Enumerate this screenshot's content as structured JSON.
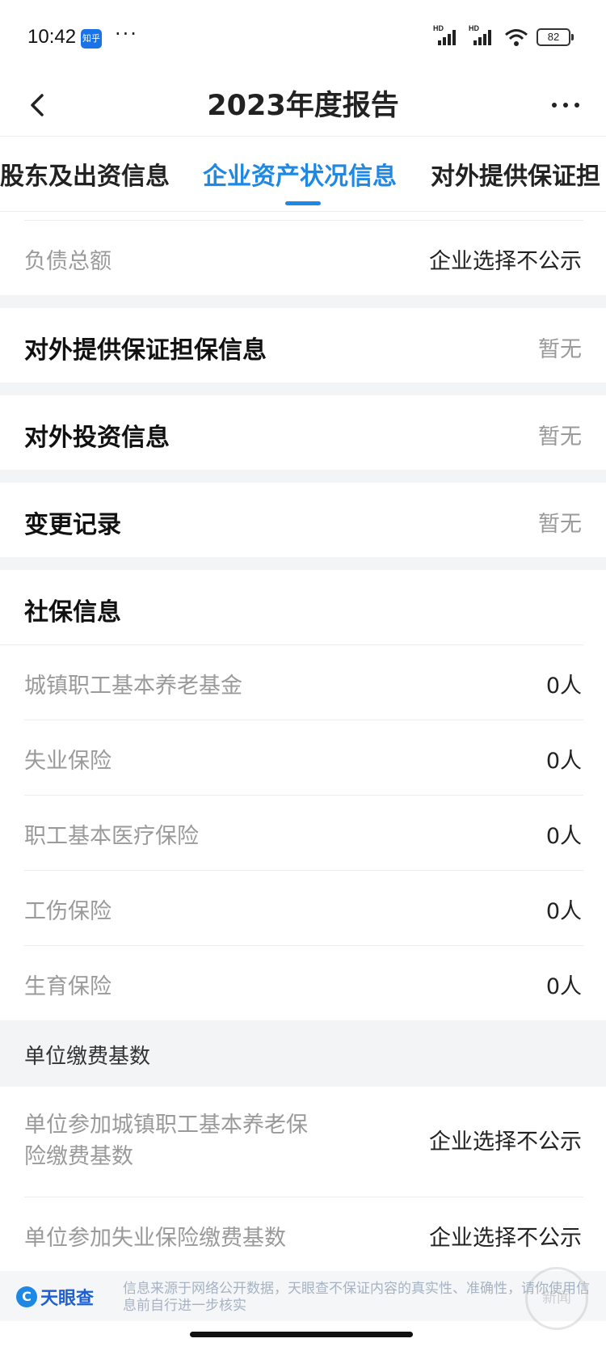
{
  "status_bar": {
    "time": "10:42",
    "app_icon_text": "知乎",
    "signal_1": "HD",
    "signal_2": "HD",
    "battery": "82"
  },
  "header": {
    "title": "2023年度报告",
    "back_icon": "chevron-left-icon",
    "more_icon": "more-horizontal-icon"
  },
  "tabs": [
    {
      "label": "股东及出资信息"
    },
    {
      "label": "企业资产状况信息",
      "active": true
    },
    {
      "label": "对外提供保证担"
    }
  ],
  "accent_color": "#1e88e5",
  "asset_rows": [
    {
      "label": "负债总额",
      "value": "企业选择不公示"
    }
  ],
  "sections": [
    {
      "title": "对外提供保证担保信息",
      "value": "暂无"
    },
    {
      "title": "对外投资信息",
      "value": "暂无"
    },
    {
      "title": "变更记录",
      "value": "暂无"
    }
  ],
  "social_security": {
    "title": "社保信息",
    "rows": [
      {
        "label": "城镇职工基本养老基金",
        "value": "0人"
      },
      {
        "label": "失业保险",
        "value": "0人"
      },
      {
        "label": "职工基本医疗保险",
        "value": "0人"
      },
      {
        "label": "工伤保险",
        "value": "0人"
      },
      {
        "label": "生育保险",
        "value": "0人"
      }
    ]
  },
  "contribution_base": {
    "title": "单位缴费基数",
    "rows": [
      {
        "label": "单位参加城镇职工基本养老保险缴费基数",
        "value": "企业选择不公示"
      },
      {
        "label": "单位参加失业保险缴费基数",
        "value": "企业选择不公示"
      }
    ]
  },
  "footer": {
    "logo_text": "天眼查",
    "disclaimer": "信息来源于网络公开数据，天眼查不保证内容的真实性、准确性，请你使用信息前自行进一步核实",
    "watermark": "新闻"
  }
}
